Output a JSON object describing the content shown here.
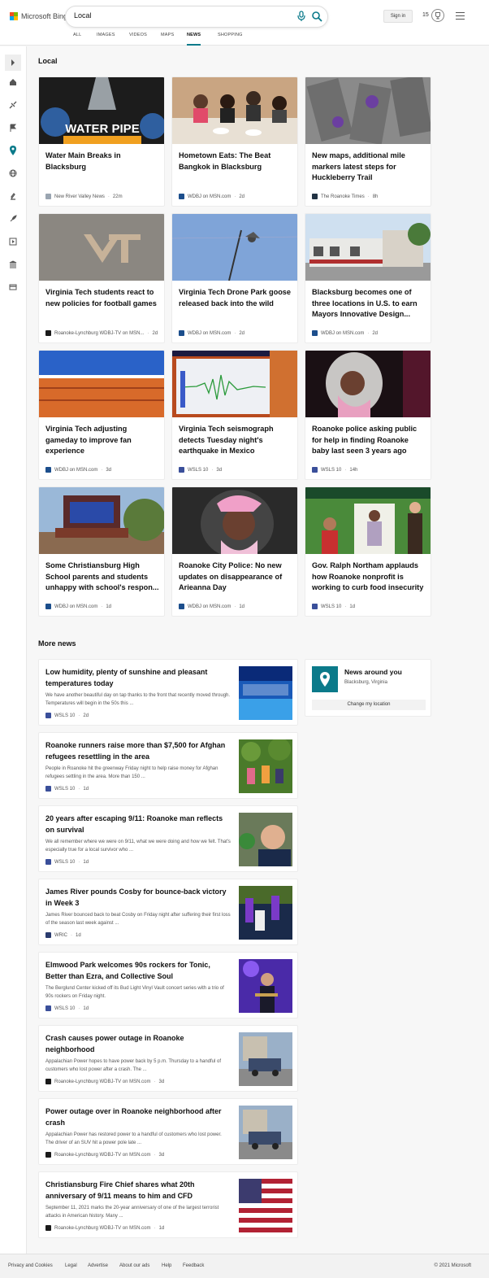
{
  "header": {
    "brand": "Microsoft Bing",
    "search_value": "Local",
    "signin_label": "Sign in",
    "rewards_count": "15",
    "tabs": [
      "ALL",
      "IMAGES",
      "VIDEOS",
      "MAPS",
      "NEWS",
      "SHOPPING"
    ],
    "active_tab": "NEWS"
  },
  "sidebar": {
    "icons": [
      "expand-icon",
      "home-icon",
      "tech-icon",
      "flag-icon",
      "location-icon",
      "globe-icon",
      "science-icon",
      "rocket-icon",
      "video-icon",
      "politics-icon",
      "money-icon"
    ],
    "active": "location-icon"
  },
  "local": {
    "title": "Local",
    "cards": [
      {
        "title": "Water Main Breaks in Blacksburg",
        "source": "New River Valley News",
        "time": "22m",
        "logo_color": "#9aa5b1"
      },
      {
        "title": "Hometown Eats: The Beat Bangkok in Blacksburg",
        "source": "WDBJ on MSN.com",
        "time": "2d",
        "logo_color": "#1c4e8c"
      },
      {
        "title": "New maps, additional mile markers latest steps for Huckleberry Trail",
        "source": "The Roanoke Times",
        "time": "8h",
        "logo_color": "#223344"
      },
      {
        "title": "Virginia Tech students react to new policies for football games",
        "source": "Roanoke-Lynchburg WDBJ-TV on MSN...",
        "time": "2d",
        "logo_color": "#1a1a1a"
      },
      {
        "title": "Virginia Tech Drone Park goose released back into the wild",
        "source": "WDBJ on MSN.com",
        "time": "2d",
        "logo_color": "#1c4e8c"
      },
      {
        "title": "Blacksburg becomes one of three locations in U.S. to earn Mayors Innovative Design...",
        "source": "WDBJ on MSN.com",
        "time": "2d",
        "logo_color": "#1c4e8c"
      },
      {
        "title": "Virginia Tech adjusting gameday to improve fan experience",
        "source": "WDBJ on MSN.com",
        "time": "3d",
        "logo_color": "#1c4e8c"
      },
      {
        "title": "Virginia Tech seismograph detects Tuesday night's earthquake in Mexico",
        "source": "WSLS 10",
        "time": "3d",
        "logo_color": "#3a4f9a"
      },
      {
        "title": "Roanoke police asking public for help in finding Roanoke baby last seen 3 years ago",
        "source": "WSLS 10",
        "time": "14h",
        "logo_color": "#3a4f9a"
      },
      {
        "title": "Some Christiansburg High School parents and students unhappy with school's respon...",
        "source": "WDBJ on MSN.com",
        "time": "1d",
        "logo_color": "#1c4e8c"
      },
      {
        "title": "Roanoke City Police: No new updates on disappearance of Arieanna Day",
        "source": "WDBJ on MSN.com",
        "time": "1d",
        "logo_color": "#1c4e8c"
      },
      {
        "title": "Gov. Ralph Northam applauds how Roanoke nonprofit is working to curb food insecurity",
        "source": "WSLS 10",
        "time": "1d",
        "logo_color": "#3a4f9a"
      }
    ]
  },
  "more_news": {
    "title": "More news",
    "items": [
      {
        "title": "Low humidity, plenty of sunshine and pleasant temperatures today",
        "snippet": "We have another beautiful day on tap thanks to the front that recently moved through. Temperatures will begin in the 50s this ...",
        "source": "WSLS 10",
        "time": "2d",
        "logo_color": "#3a4f9a"
      },
      {
        "title": "Roanoke runners raise more than $7,500 for Afghan refugees resettling in the area",
        "snippet": "People in Roanoke hit the greenway Friday night to help raise money for Afghan refugees settling in the area. More than 150 ...",
        "source": "WSLS 10",
        "time": "1d",
        "logo_color": "#3a4f9a"
      },
      {
        "title": "20 years after escaping 9/11: Roanoke man reflects on survival",
        "snippet": "We all remember where we were on 9/11, what we were doing and how we felt. That's especially true for a local survivor who ...",
        "source": "WSLS 10",
        "time": "1d",
        "logo_color": "#3a4f9a"
      },
      {
        "title": "James River pounds Cosby for bounce-back victory in Week 3",
        "snippet": "James River bounced back to beat Cosby on Friday night after suffering their first loss of the season last week against ...",
        "source": "WRIC",
        "time": "1d",
        "logo_color": "#2a3b6e"
      },
      {
        "title": "Elmwood Park welcomes 90s rockers for Tonic, Better than Ezra, and Collective Soul",
        "snippet": "The Berglund Center kicked off its Bud Light Vinyl Vault concert series with a trio of 90s rockers on Friday night.",
        "source": "WSLS 10",
        "time": "1d",
        "logo_color": "#3a4f9a"
      },
      {
        "title": "Crash causes power outage in Roanoke neighborhood",
        "snippet": "Appalachian Power hopes to have power back by 5 p.m. Thursday to a handful of customers who lost power after a crash. The ...",
        "source": "Roanoke-Lynchburg WDBJ-TV on MSN.com",
        "time": "3d",
        "logo_color": "#1a1a1a"
      },
      {
        "title": "Power outage over in Roanoke neighborhood after crash",
        "snippet": "Appalachian Power has restored power to a handful of customers who lost power. The driver of an SUV hit a power pole late ...",
        "source": "Roanoke-Lynchburg WDBJ-TV on MSN.com",
        "time": "3d",
        "logo_color": "#1a1a1a"
      },
      {
        "title": "Christiansburg Fire Chief shares what 20th anniversary of 9/11 means to him and CFD",
        "snippet": "September 11, 2021 marks the 20-year anniversary of one of the largest terrorist attacks in American history. Many ...",
        "source": "Roanoke-Lynchburg WDBJ-TV on MSN.com",
        "time": "1d",
        "logo_color": "#1a1a1a"
      }
    ]
  },
  "around": {
    "title": "News around you",
    "location": "Blacksburg, Virginia",
    "button": "Change my location"
  },
  "footer": {
    "links": [
      "Privacy and Cookies",
      "Legal",
      "Advertise",
      "About our ads",
      "Help",
      "Feedback"
    ],
    "copyright": "© 2021 Microsoft"
  }
}
